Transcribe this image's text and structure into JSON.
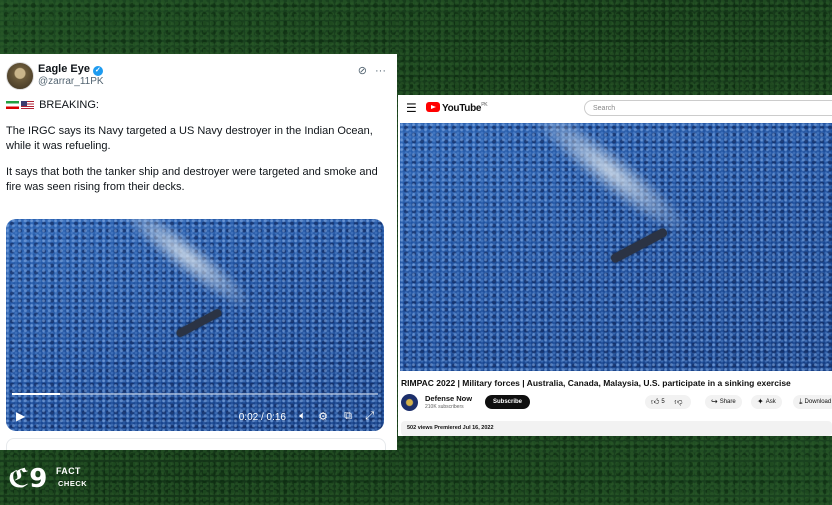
{
  "tweet": {
    "name": "Eagle Eye",
    "handle": "@zarrar_11PK",
    "header_text": "BREAKING:",
    "paragraph1": "The IRGC says its Navy targeted a US Navy destroyer in the Indian Ocean, while it was refueling.",
    "paragraph2": "It says that both the tanker ship and destroyer were targeted and smoke and fire was seen rising from their decks.",
    "video": {
      "time": "0:02 / 0:16",
      "progress": 0.13
    },
    "icons": [
      "grok-icon",
      "more-icon",
      "play-icon",
      "volume-icon",
      "settings-icon",
      "pip-icon",
      "fullscreen-icon"
    ]
  },
  "youtube": {
    "logo_text": "YouTube",
    "logo_region": "PK",
    "search_placeholder": "Search",
    "title": "RIMPAC 2022 | Military forces | Australia, Canada, Malaysia, U.S. participate in a sinking exercise",
    "channel_name": "Defense Now",
    "subscribers": "210K subscribers",
    "subscribe_label": "Subscribe",
    "likes": "5",
    "share_label": "Share",
    "ask_label": "Ask",
    "download_label": "Download",
    "meta": "502 views  Premiered Jul 16, 2022",
    "accent": "#ff0000"
  },
  "logo": {
    "line1": "FACT",
    "line2": "CHECK"
  }
}
